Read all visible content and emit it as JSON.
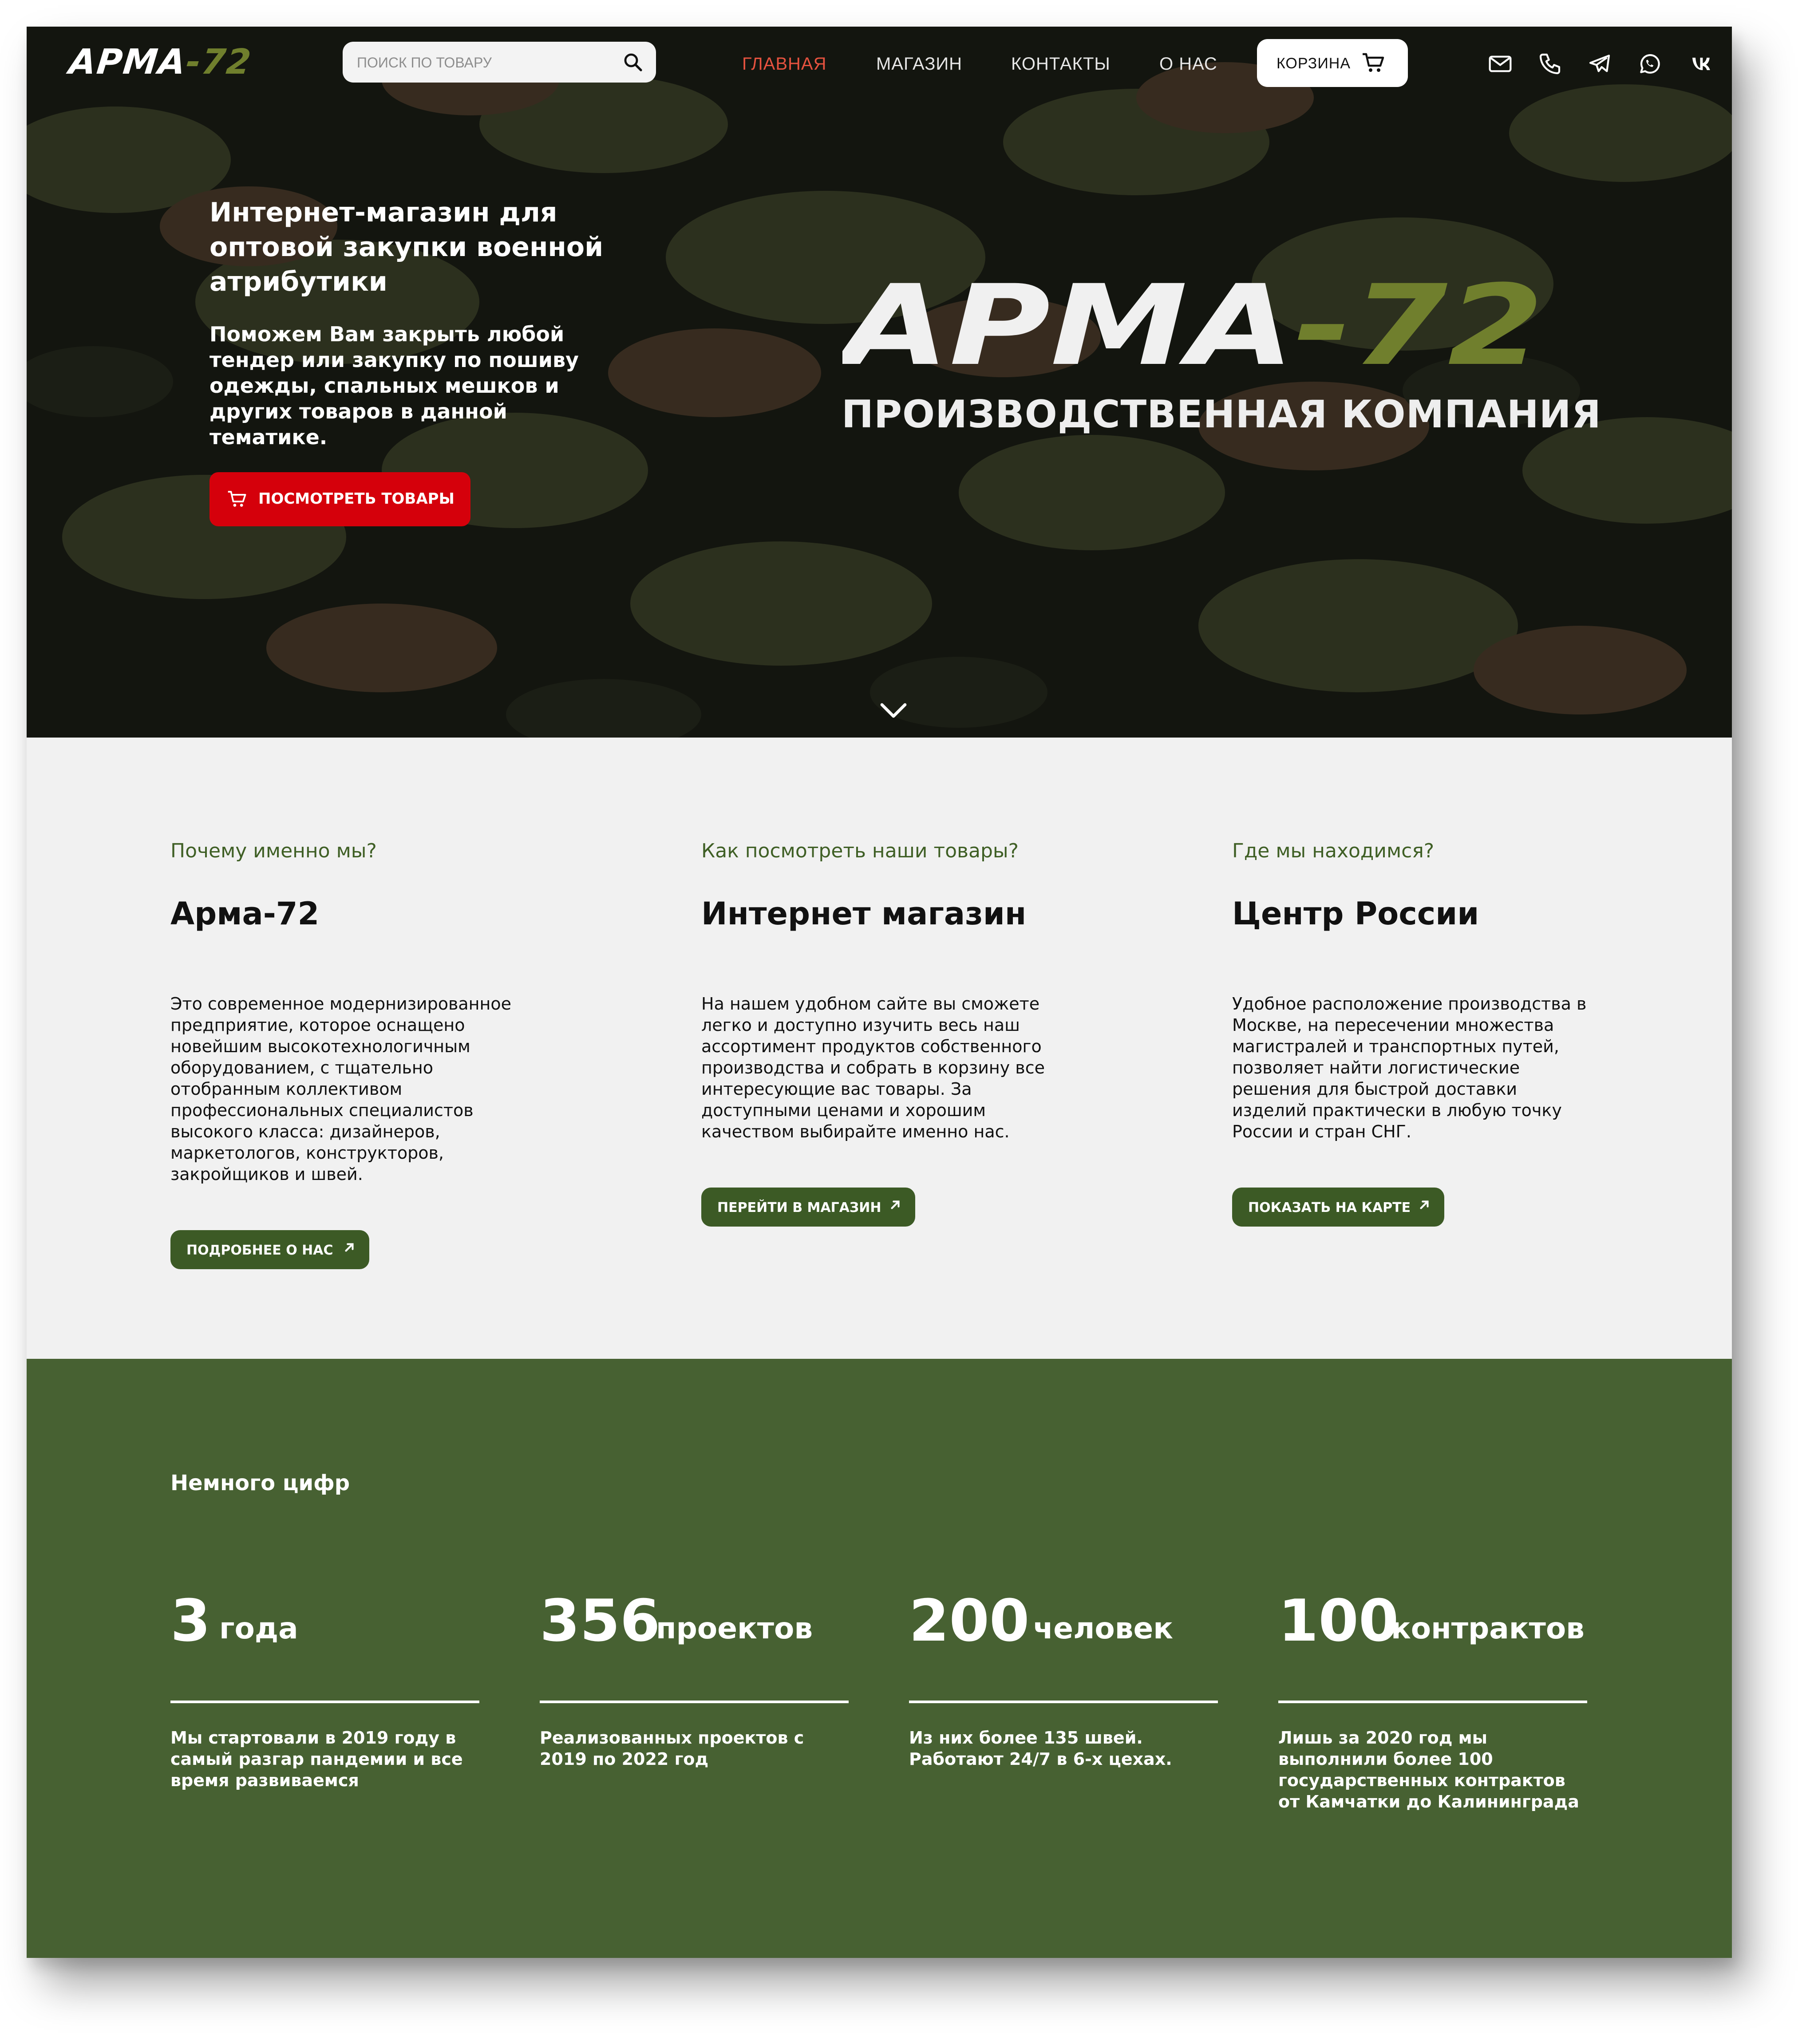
{
  "brand": {
    "logo_white": "АРМА",
    "logo_accent": "-72",
    "accent_color": "#707f2d"
  },
  "search": {
    "placeholder": "ПОИСК ПО ТОВАРУ",
    "value": ""
  },
  "nav": {
    "items": [
      {
        "label": "ГЛАВНАЯ",
        "active": true
      },
      {
        "label": "МАГАЗИН",
        "active": false
      },
      {
        "label": "КОНТАКТЫ",
        "active": false
      },
      {
        "label": "О НАС",
        "active": false
      }
    ],
    "active_color": "#e5523f"
  },
  "cart": {
    "label": "КОРЗИНА",
    "icon": "cart-icon"
  },
  "social": [
    "mail-icon",
    "phone-icon",
    "telegram-icon",
    "whatsapp-icon",
    "vk-icon"
  ],
  "hero": {
    "title": "Интернет-магазин для оптовой закупки военной атрибутики",
    "subtitle": "Поможем Вам закрыть любой тендер или закупку по пошиву одежды, спальных мешков и других товаров в данной тематике.",
    "cta_label": "ПОСМОТРЕТЬ ТОВАРЫ",
    "cta_color": "#d5000b",
    "big_logo_white": "АРМА",
    "big_logo_accent": "-72",
    "company_label": "ПРОИЗВОДСТВЕННАЯ КОМПАНИЯ"
  },
  "features": [
    {
      "kicker": "Почему именно мы?",
      "heading": "Арма-72",
      "body": "Это современное модернизированное предприятие, которое оснащено новейшим высокотехнологичным оборудованием, с тщательно отобранным коллективом профессиональных специалистов высокого класса: дизайнеров, маркетологов, конструкторов, закройщиков и швей.",
      "button": "ПОДРОБНЕЕ О НАС"
    },
    {
      "kicker": "Как посмотреть наши товары?",
      "heading": "Интернет магазин",
      "body": "На нашем удобном сайте вы сможете легко и доступно изучить весь наш ассортимент продуктов собственного производства и собрать в корзину все интересующие вас товары. За доступными ценами и хорошим качеством выбирайте именно нас.",
      "button": "ПЕРЕЙТИ В МАГАЗИН"
    },
    {
      "kicker": "Где мы находимся?",
      "heading": "Центр России",
      "body": "Удобное расположение производства в Москве, на пересечении множества магистралей и транспортных путей, позволяет найти логистические решения для быстрой доставки изделий практически в любую точку России и стран СНГ.",
      "button": "ПОКАЗАТЬ НА КАРТЕ"
    }
  ],
  "stats": {
    "title": "Немного цифр",
    "items": [
      {
        "number": "3",
        "unit": "года",
        "desc": "Мы стартовали в 2019 году в самый разгар пандемии и все время развиваемся"
      },
      {
        "number": "356",
        "unit": "проектов",
        "desc": "Реализованных проектов с 2019 по 2022 год"
      },
      {
        "number": "200",
        "unit": "человек",
        "desc": "Из них более 135 швей. Работают 24/7 в 6-х цехах."
      },
      {
        "number": "100",
        "unit": "контрактов",
        "desc": "Лишь за 2020 год мы выполнили более 100 государственных контрактов от Камчатки до Калининграда"
      }
    ],
    "bg_color": "#476132"
  }
}
